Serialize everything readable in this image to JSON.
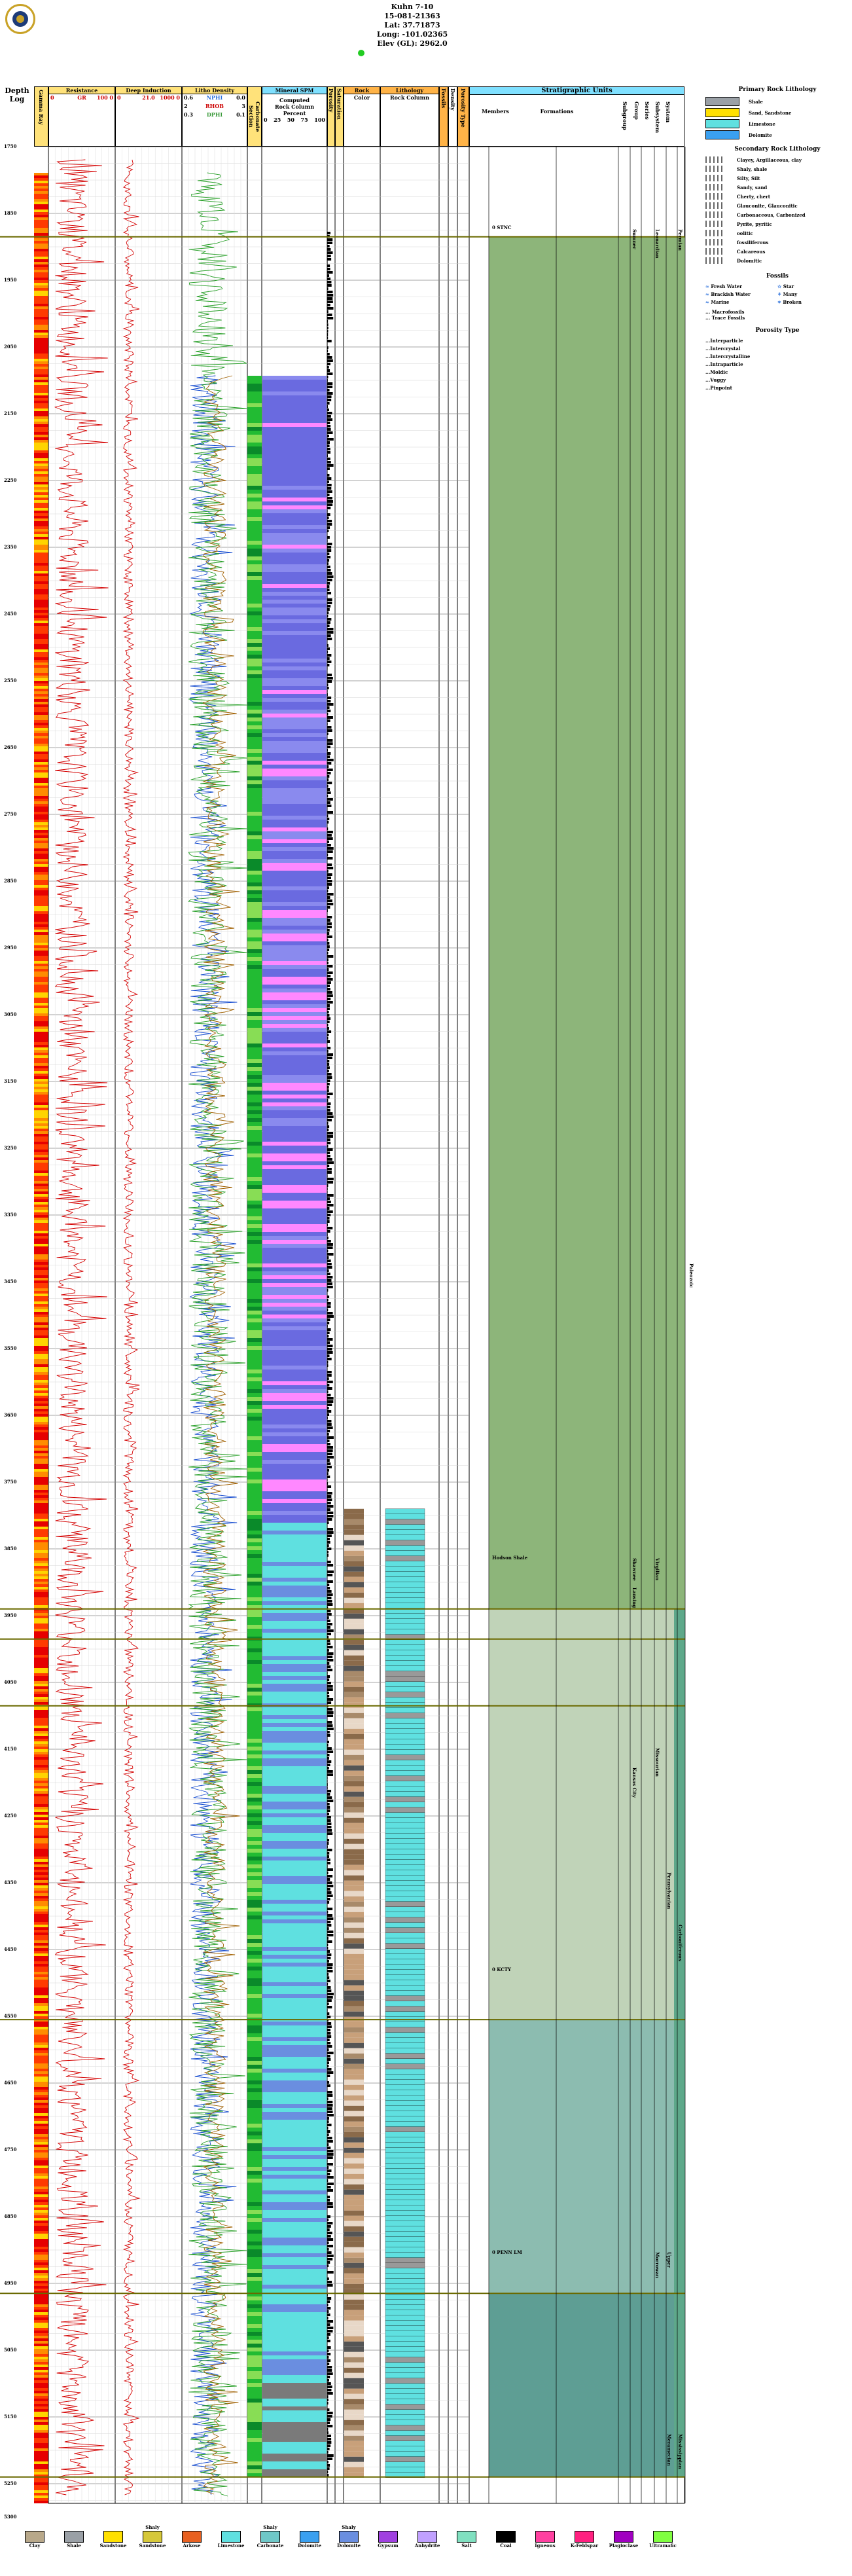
{
  "well_header": {
    "name": "Kuhn 7-10",
    "api": "15-081-21363",
    "lat": "Lat: 37.71873",
    "long": "Long: -101.02365",
    "elev": "Elev (GL): 2962.0"
  },
  "columns": {
    "depth": "Depth",
    "log": "Log",
    "gamma_ray": "Gamma Ray",
    "resistance": "Resistance",
    "resistance_gr": "GR",
    "resistance_scale": "100 0",
    "resistance_left": "0",
    "deep_induction": "Deep Induction",
    "deep_scale_l": "0",
    "deep_scale_m": "21.0",
    "deep_scale_r": "1000 0",
    "litho_density": "Litho Density",
    "ld_r1": "NPHI",
    "ld_r2": "RHOB",
    "ld_r3": "DPHI",
    "ld_l1": "0.6",
    "ld_l2": "2",
    "ld_l3": "0.3",
    "ld_rv1": "0.0",
    "ld_rv2": "3",
    "ld_rv3": "0.1",
    "carbonate": "Carbonate Section",
    "mineral_spm": "Mineral SPM",
    "computed": "Computed",
    "rock_column": "Rock Column",
    "percent": "Percent",
    "pct_scale": [
      "0",
      "25",
      "50",
      "75",
      "100"
    ],
    "porosity": "Porosity",
    "saturation": "Saturation",
    "rock_color_head": "Rock",
    "rock_color_sub": "Color",
    "lithology": "Lithology",
    "rock_column2": "Rock Column",
    "fossils": "Fossils",
    "porosity_type": "Porosity Type",
    "density": "Density",
    "stratigraphic_units": "Stratigraphic Units",
    "members": "Members",
    "formations": "Formations",
    "subgroup": "Subgroup",
    "group": "Group",
    "series": "Series",
    "subsystem": "Subsystem",
    "system": "System"
  },
  "depths": [
    "1750",
    "1850",
    "1950",
    "2050",
    "2150",
    "2250",
    "2350",
    "2450",
    "2550",
    "2650",
    "2750",
    "2850",
    "2950",
    "3050",
    "3150",
    "3250",
    "3350",
    "3450",
    "3550",
    "3650",
    "3750",
    "3850",
    "3950",
    "4050",
    "4150",
    "4250",
    "4350",
    "4450",
    "4550",
    "4650",
    "4750",
    "4850",
    "4950",
    "5050",
    "5150",
    "5250",
    "5300"
  ],
  "tops": [
    {
      "label": "0 STNC"
    },
    {
      "label": "Hodson Shale"
    },
    {
      "label": "0 KCTY"
    },
    {
      "label": "0 PENN LM"
    }
  ],
  "strat_text": {
    "permian": "Permian",
    "leonardian": "Leonardian",
    "sumner": "Sumner",
    "paleozoic": "Paleozoic",
    "virgilian": "Virgilian",
    "shawnee": "Shawnee",
    "lansing": "Lansing",
    "missourian": "Missourian",
    "kansas_city": "Kansas City",
    "pennsylvanian": "Pennsylvanian",
    "carboniferous": "Carboniferous",
    "upper": "Upper",
    "morrowan": "Morrowan",
    "mississippian": "Mississippian",
    "meramecian": "Meramecian"
  },
  "legend": {
    "primary_title": "Primary Rock Lithology",
    "primary": [
      {
        "label": "Shale",
        "color": "#9aa0a6"
      },
      {
        "label": "Sand, Sandstone",
        "color": "#ffe000"
      },
      {
        "label": "Limestone",
        "color": "#5fe0e0"
      },
      {
        "label": "Dolomite",
        "color": "#3aa0f0"
      }
    ],
    "secondary_title": "Secondary Rock Lithology",
    "secondary": [
      "Clayey, Argillaceous, clay",
      "Shaly, shale",
      "Silty, Silt",
      "Sandy, sand",
      "Cherty, chert",
      "Glauconite, Glauconitic",
      "Carbonaceous, Carbonized",
      "Pyrite, pyritic",
      "oolitic",
      "fossiliferous",
      "Calcareous",
      "Dolomitic"
    ],
    "fossils_title": "Fossils",
    "fossils": [
      {
        "label": "Fresh Water",
        "sym": "≈"
      },
      {
        "label": "Star",
        "sym": "☆"
      },
      {
        "label": "Brackish Water",
        "sym": "≈"
      },
      {
        "label": "Many",
        "sym": "⚘"
      },
      {
        "label": "Marine",
        "sym": "≈"
      },
      {
        "label": "Broken",
        "sym": "✶"
      }
    ],
    "fossil_lines": [
      "... Macrofossils",
      "... Trace Fossils"
    ],
    "porosity_title": "Porosity Type",
    "porosity": [
      "...Interparticle",
      "...Intercrystal",
      "...Intercrystalline",
      "...Intraparticle",
      "...Moldic",
      "...Vuggy",
      "...Pinpoint"
    ]
  },
  "bottom_legend": [
    {
      "top": "",
      "label": "Clay",
      "color": "#b8a88a"
    },
    {
      "top": "",
      "label": "Shale",
      "color": "#9aa0a6"
    },
    {
      "top": "",
      "label": "Sandstone",
      "color": "#ffe000"
    },
    {
      "top": "Shaly",
      "label": "Sandstone",
      "color": "#d6c83a"
    },
    {
      "top": "",
      "label": "Arkose",
      "color": "#e86020"
    },
    {
      "top": "",
      "label": "Limestone",
      "color": "#5fe0e0"
    },
    {
      "top": "Shaly",
      "label": "Carbonate",
      "color": "#6fc8c8"
    },
    {
      "top": "",
      "label": "Dolomite",
      "color": "#3aa0f0"
    },
    {
      "top": "Shaly",
      "label": "Dolomite",
      "color": "#6a8ee0"
    },
    {
      "top": "",
      "label": "Gypsum",
      "color": "#a040e0"
    },
    {
      "top": "",
      "label": "Anhydrite",
      "color": "#c0a0ff"
    },
    {
      "top": "",
      "label": "Salt",
      "color": "#80e0c0"
    },
    {
      "top": "",
      "label": "Coal",
      "color": "#000000"
    },
    {
      "top": "",
      "label": "Igneous",
      "color": "#ff40a0"
    },
    {
      "top": "",
      "label": "K-Feldspar",
      "color": "#ff2080"
    },
    {
      "top": "",
      "label": "Plagioclase",
      "color": "#a000c0"
    },
    {
      "top": "",
      "label": "Ultramafic",
      "color": "#80ff40"
    }
  ]
}
